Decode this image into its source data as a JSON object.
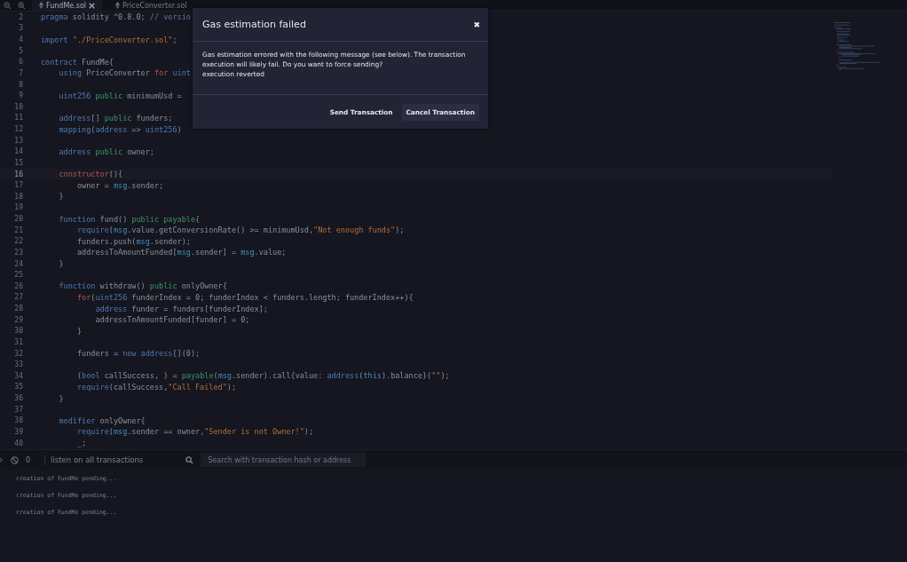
{
  "tabs": [
    {
      "label": "FundMe.sol",
      "selected": true,
      "closable": true
    },
    {
      "label": "PriceConverter.sol",
      "selected": false,
      "closable": false
    }
  ],
  "editor": {
    "lines": [
      {
        "number": "2",
        "current": false,
        "tokens": [
          {
            "kind": "kw",
            "text": "pragma"
          },
          {
            "kind": "plain",
            "text": " solidity ^0.8.0; "
          },
          {
            "kind": "cm",
            "text": "// versio"
          }
        ]
      },
      {
        "number": "3",
        "current": false
      },
      {
        "number": "4",
        "current": false,
        "tokens": [
          {
            "kind": "kw",
            "text": "import"
          },
          {
            "kind": "str",
            "text": " \"./PriceConverter.sol\""
          },
          {
            "kind": "plain",
            "text": ";"
          }
        ]
      },
      {
        "number": "5",
        "current": false
      },
      {
        "number": "6",
        "current": false,
        "tokens": [
          {
            "kind": "kw",
            "text": "contract"
          },
          {
            "kind": "plain",
            "text": " FundMe{"
          }
        ]
      },
      {
        "number": "7",
        "current": false,
        "tokens": [
          {
            "kind": "kw",
            "text": "    using"
          },
          {
            "kind": "plain",
            "text": " PriceConverter "
          },
          {
            "kind": "ctl",
            "text": "for"
          },
          {
            "kind": "kw",
            "text": " uint"
          }
        ]
      },
      {
        "number": "8",
        "current": false
      },
      {
        "number": "9",
        "current": false,
        "tokens": [
          {
            "kind": "kw",
            "text": "    uint256"
          },
          {
            "kind": "mod",
            "text": " public"
          },
          {
            "kind": "plain",
            "text": " minimumUsd ="
          }
        ]
      },
      {
        "number": "10",
        "current": false
      },
      {
        "number": "11",
        "current": false,
        "tokens": [
          {
            "kind": "kw",
            "text": "    address"
          },
          {
            "kind": "plain",
            "text": "[] "
          },
          {
            "kind": "mod",
            "text": "public"
          },
          {
            "kind": "plain",
            "text": " funders;"
          }
        ]
      },
      {
        "number": "12",
        "current": false,
        "tokens": [
          {
            "kind": "kw",
            "text": "    mapping"
          },
          {
            "kind": "plain",
            "text": "("
          },
          {
            "kind": "kw",
            "text": "address"
          },
          {
            "kind": "plain",
            "text": " => "
          },
          {
            "kind": "kw",
            "text": "uint256"
          },
          {
            "kind": "plain",
            "text": ")"
          }
        ]
      },
      {
        "number": "13",
        "current": false
      },
      {
        "number": "14",
        "current": false,
        "tokens": [
          {
            "kind": "kw",
            "text": "    address"
          },
          {
            "kind": "mod",
            "text": " public"
          },
          {
            "kind": "plain",
            "text": " owner;"
          }
        ]
      },
      {
        "number": "15",
        "current": false
      },
      {
        "number": "16",
        "current": true,
        "tokens": [
          {
            "kind": "ctl",
            "text": "    constructor"
          },
          {
            "kind": "plain",
            "text": "(){"
          }
        ]
      },
      {
        "number": "17",
        "current": false,
        "tokens": [
          {
            "kind": "plain",
            "text": "        owner = "
          },
          {
            "kind": "var",
            "text": "msg"
          },
          {
            "kind": "plain",
            "text": ".sender;"
          }
        ]
      },
      {
        "number": "18",
        "current": false,
        "tokens": [
          {
            "kind": "plain",
            "text": "    }"
          }
        ]
      },
      {
        "number": "19",
        "current": false
      },
      {
        "number": "20",
        "current": false,
        "tokens": [
          {
            "kind": "kw",
            "text": "    function"
          },
          {
            "kind": "plain",
            "text": " fund() "
          },
          {
            "kind": "mod",
            "text": "public payable"
          },
          {
            "kind": "plain",
            "text": "{"
          }
        ]
      },
      {
        "number": "21",
        "current": false,
        "tokens": [
          {
            "kind": "kw",
            "text": "        require"
          },
          {
            "kind": "plain",
            "text": "("
          },
          {
            "kind": "var",
            "text": "msg"
          },
          {
            "kind": "plain",
            "text": ".value.getConversionRate() >= minimumUsd,"
          },
          {
            "kind": "str",
            "text": "\"Not enough funds\""
          },
          {
            "kind": "plain",
            "text": ");"
          }
        ]
      },
      {
        "number": "22",
        "current": false,
        "tokens": [
          {
            "kind": "plain",
            "text": "        funders.push("
          },
          {
            "kind": "var",
            "text": "msg"
          },
          {
            "kind": "plain",
            "text": ".sender);"
          }
        ]
      },
      {
        "number": "23",
        "current": false,
        "tokens": [
          {
            "kind": "plain",
            "text": "        addressToAmountFunded["
          },
          {
            "kind": "var",
            "text": "msg"
          },
          {
            "kind": "plain",
            "text": ".sender] = "
          },
          {
            "kind": "var",
            "text": "msg"
          },
          {
            "kind": "plain",
            "text": ".value;"
          }
        ]
      },
      {
        "number": "24",
        "current": false,
        "tokens": [
          {
            "kind": "plain",
            "text": "    }"
          }
        ]
      },
      {
        "number": "25",
        "current": false
      },
      {
        "number": "26",
        "current": false,
        "tokens": [
          {
            "kind": "kw",
            "text": "    function"
          },
          {
            "kind": "plain",
            "text": " withdraw() "
          },
          {
            "kind": "mod",
            "text": "public"
          },
          {
            "kind": "plain",
            "text": " onlyOwner{"
          }
        ]
      },
      {
        "number": "27",
        "current": false,
        "tokens": [
          {
            "kind": "ctl",
            "text": "        for"
          },
          {
            "kind": "plain",
            "text": "("
          },
          {
            "kind": "kw",
            "text": "uint256"
          },
          {
            "kind": "plain",
            "text": " funderIndex = 0; funderIndex < funders.length; funderIndex++){"
          }
        ]
      },
      {
        "number": "28",
        "current": false,
        "tokens": [
          {
            "kind": "kw",
            "text": "            address"
          },
          {
            "kind": "plain",
            "text": " funder = funders[funderIndex];"
          }
        ]
      },
      {
        "number": "29",
        "current": false,
        "tokens": [
          {
            "kind": "plain",
            "text": "            addressToAmountFunded[funder] = 0;"
          }
        ]
      },
      {
        "number": "30",
        "current": false,
        "tokens": [
          {
            "kind": "plain",
            "text": "        }"
          }
        ]
      },
      {
        "number": "31",
        "current": false
      },
      {
        "number": "32",
        "current": false,
        "tokens": [
          {
            "kind": "plain",
            "text": "        funders = "
          },
          {
            "kind": "kw",
            "text": "new address"
          },
          {
            "kind": "plain",
            "text": "[](0);"
          }
        ]
      },
      {
        "number": "33",
        "current": false
      },
      {
        "number": "34",
        "current": false,
        "tokens": [
          {
            "kind": "plain",
            "text": "        ("
          },
          {
            "kind": "kw",
            "text": "bool"
          },
          {
            "kind": "plain",
            "text": " callSuccess, ) = "
          },
          {
            "kind": "mod",
            "text": "payable"
          },
          {
            "kind": "plain",
            "text": "("
          },
          {
            "kind": "var",
            "text": "msg"
          },
          {
            "kind": "plain",
            "text": ".sender).call{value: "
          },
          {
            "kind": "kw",
            "text": "address"
          },
          {
            "kind": "plain",
            "text": "("
          },
          {
            "kind": "var",
            "text": "this"
          },
          {
            "kind": "plain",
            "text": ").balance}("
          },
          {
            "kind": "str",
            "text": "\"\""
          },
          {
            "kind": "plain",
            "text": ");"
          }
        ]
      },
      {
        "number": "35",
        "current": false,
        "tokens": [
          {
            "kind": "kw",
            "text": "        require"
          },
          {
            "kind": "plain",
            "text": "(callSuccess,"
          },
          {
            "kind": "str",
            "text": "\"Call Failed\""
          },
          {
            "kind": "plain",
            "text": ");"
          }
        ]
      },
      {
        "number": "36",
        "current": false,
        "tokens": [
          {
            "kind": "plain",
            "text": "    }"
          }
        ]
      },
      {
        "number": "37",
        "current": false
      },
      {
        "number": "38",
        "current": false,
        "tokens": [
          {
            "kind": "kw",
            "text": "    modifier"
          },
          {
            "kind": "plain",
            "text": " onlyOwner{"
          }
        ]
      },
      {
        "number": "39",
        "current": false,
        "tokens": [
          {
            "kind": "kw",
            "text": "        require"
          },
          {
            "kind": "plain",
            "text": "("
          },
          {
            "kind": "var",
            "text": "msg"
          },
          {
            "kind": "plain",
            "text": ".sender == owner,"
          },
          {
            "kind": "str",
            "text": "\"Sender is not Owner!\""
          },
          {
            "kind": "plain",
            "text": ");"
          }
        ]
      },
      {
        "number": "40",
        "current": false,
        "tokens": [
          {
            "kind": "plain",
            "text": "        _;"
          }
        ]
      }
    ]
  },
  "terminal": {
    "count": "0",
    "listen": {
      "label": "listen on all transactions",
      "checked": false
    },
    "search": {
      "placeholder": "Search with transaction hash or address"
    },
    "logs": [
      "creation of FundMe pending...",
      "creation of FundMe pending...",
      "creation of FundMe pending..."
    ]
  },
  "dialog": {
    "title": "Gas estimation failed",
    "close": "✖",
    "message": "Gas estimation errored with the following message (see below). The transaction execution will likely fail. Do you want to force sending?",
    "error": "execution reverted",
    "buttons": [
      {
        "label": "Send Transaction",
        "kind": "plain"
      },
      {
        "label": "Cancel Transaction",
        "kind": "filled"
      }
    ]
  }
}
